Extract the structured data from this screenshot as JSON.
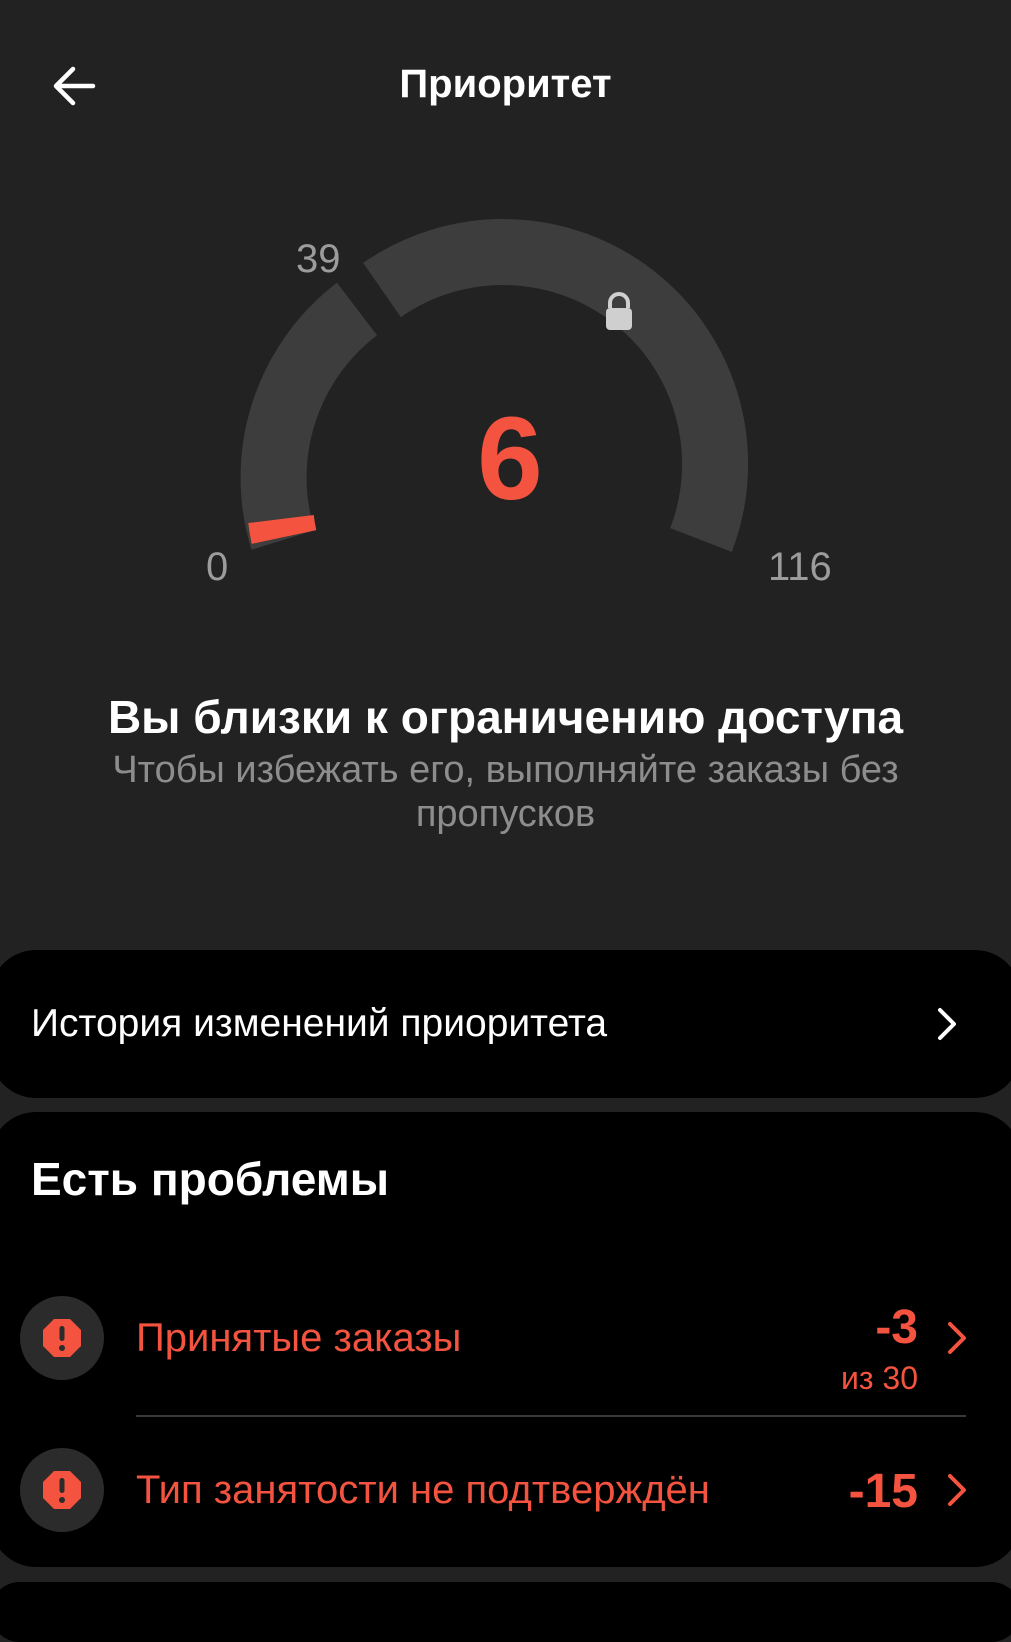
{
  "header": {
    "title": "Приоритет",
    "back_icon": "arrow-left-icon"
  },
  "gauge": {
    "value": "6",
    "min_label": "0",
    "mid_label": "39",
    "max_label": "116",
    "lock_icon": "lock-icon",
    "colors": {
      "track": "#3d3d3d",
      "indicator": "#f4543f"
    }
  },
  "status": {
    "title": "Вы близки к ограничению доступа",
    "subtitle": "Чтобы избежать его, выполняйте заказы без пропусков"
  },
  "history": {
    "label": "История изменений приоритета",
    "chevron_icon": "chevron-right-icon"
  },
  "problems": {
    "title": "Есть проблемы",
    "items": [
      {
        "label": "Принятые заказы",
        "value": "-3",
        "sub": "из 30",
        "icon": "warning-icon"
      },
      {
        "label": "Тип занятости не подтверждён",
        "value": "-15",
        "icon": "warning-icon"
      }
    ]
  },
  "colors": {
    "background": "#222222",
    "card": "#000000",
    "accent": "#f4543f"
  }
}
